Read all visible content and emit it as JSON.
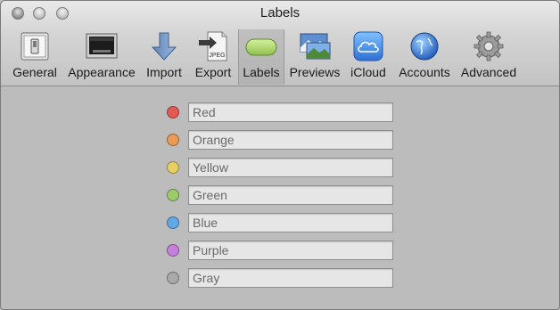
{
  "window": {
    "title": "Labels"
  },
  "toolbar": {
    "items": [
      {
        "label": "General",
        "icon": "general-switch-icon"
      },
      {
        "label": "Appearance",
        "icon": "appearance-monitor-icon"
      },
      {
        "label": "Import",
        "icon": "import-arrow-icon"
      },
      {
        "label": "Export",
        "icon": "export-jpeg-icon"
      },
      {
        "label": "Labels",
        "icon": "labels-pill-icon",
        "selected": true
      },
      {
        "label": "Previews",
        "icon": "previews-photos-icon"
      },
      {
        "label": "iCloud",
        "icon": "icloud-icon"
      },
      {
        "label": "Accounts",
        "icon": "accounts-globe-icon"
      },
      {
        "label": "Advanced",
        "icon": "advanced-gear-icon"
      }
    ]
  },
  "labels": [
    {
      "placeholder": "Red",
      "color": "#e35a55"
    },
    {
      "placeholder": "Orange",
      "color": "#ec9a55"
    },
    {
      "placeholder": "Yellow",
      "color": "#e5cf63"
    },
    {
      "placeholder": "Green",
      "color": "#9bcc69"
    },
    {
      "placeholder": "Blue",
      "color": "#63a8e6"
    },
    {
      "placeholder": "Purple",
      "color": "#c57fdc"
    },
    {
      "placeholder": "Gray",
      "color": "#aaaaaa"
    }
  ]
}
